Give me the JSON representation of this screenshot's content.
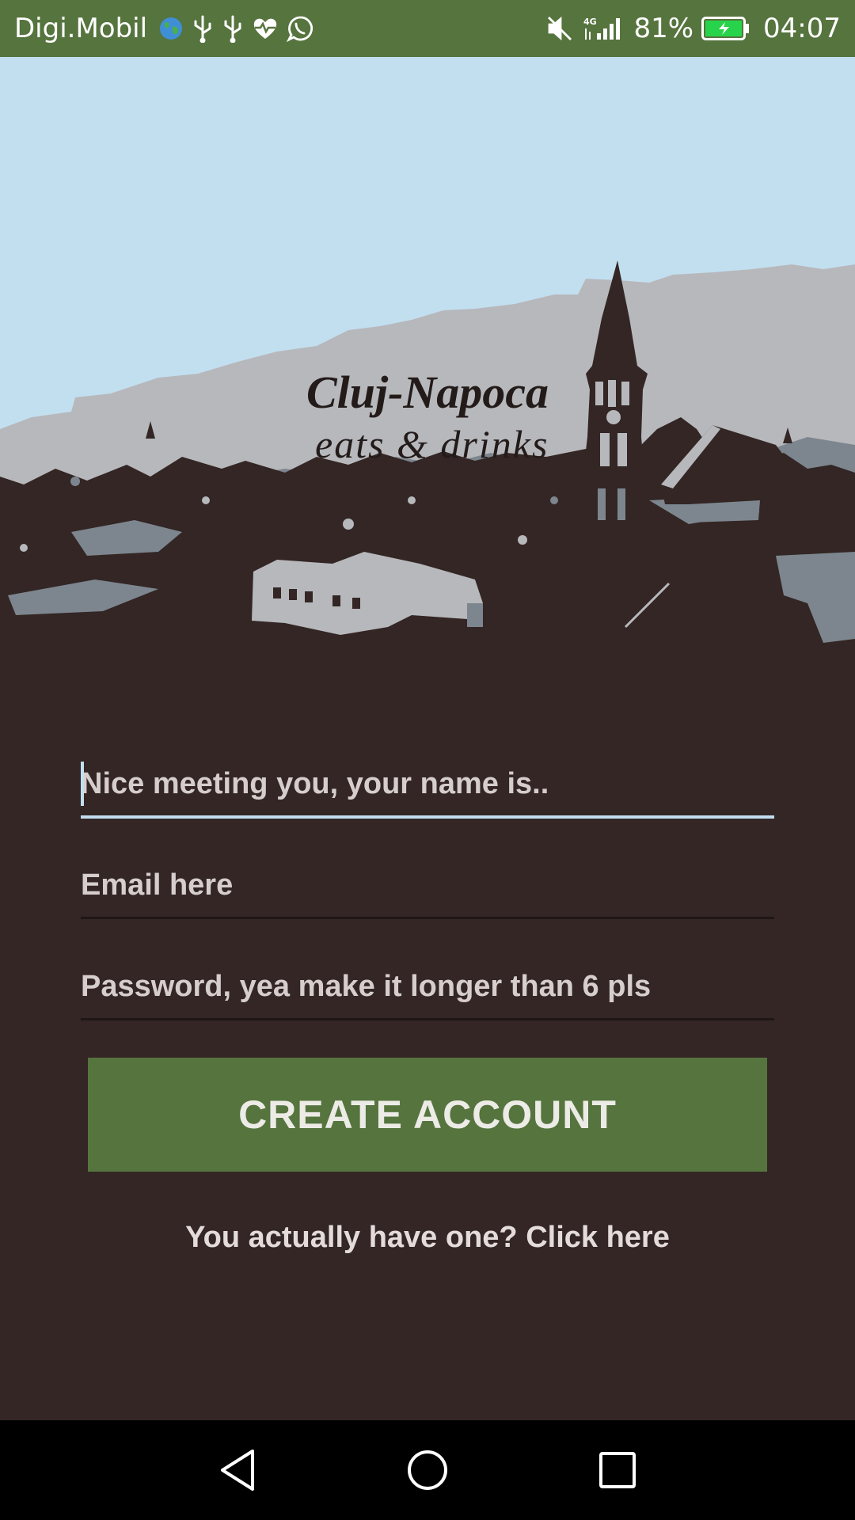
{
  "status_bar": {
    "carrier": "Digi.Mobil",
    "battery_percent": "81%",
    "time": "04:07",
    "network": "4G",
    "icons": [
      "globe-icon",
      "usb-icon",
      "usb-icon",
      "heart-pulse-icon",
      "whatsapp-icon",
      "mute-icon",
      "signal-icon",
      "battery-charging-icon"
    ]
  },
  "hero": {
    "title": "Cluj-Napoca",
    "subtitle": "eats & drinks"
  },
  "form": {
    "name_placeholder": "Nice meeting you, your name is..",
    "email_placeholder": "Email here",
    "password_placeholder": "Password, yea make it longer than 6 pls",
    "create_button_label": "CREATE ACCOUNT",
    "login_link_label": "You actually have one? Click here"
  },
  "nav_bar": {
    "buttons": [
      "back-icon",
      "home-icon",
      "recents-icon"
    ]
  },
  "colors": {
    "status_bar": "#56743e",
    "background": "#332625",
    "sky": "#c2dff0",
    "accent_button": "#56743e",
    "focus_underline": "#c2dff0"
  }
}
